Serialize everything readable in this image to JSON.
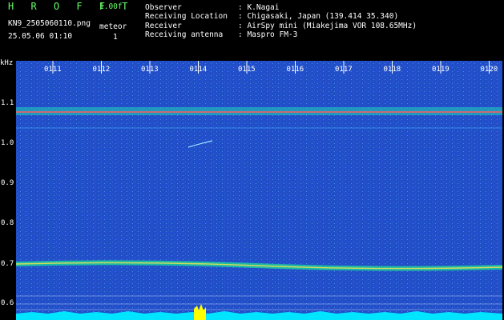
{
  "header": {
    "program": "H R O F F T",
    "version": "1.00f",
    "filename": "KN9_2505060110.png",
    "datetime": "25.05.06 01:10",
    "meteor_label": "meteor",
    "meteor_count": "1"
  },
  "info": {
    "labels": [
      "Observer",
      "Receiving Location",
      "Receiver",
      "Receiving antenna"
    ],
    "values": [
      ": K.Nagai",
      ": Chigasaki, Japan (139.414 35.340)",
      ": AirSpy mini (Miakejima VOR 108.65MHz)",
      ": Maspro FM-3"
    ]
  },
  "axis": {
    "y_unit": "kHz",
    "y_ticks": [
      "1.1",
      "1.0",
      "0.9",
      "0.8",
      "0.7",
      "0.6"
    ],
    "x_ticks": [
      "0111",
      "0112",
      "0113",
      "0114",
      "0115",
      "0116",
      "0117",
      "0118",
      "0119",
      "0120"
    ]
  },
  "colors": {
    "background_noise": "#0a1a6e",
    "signal": "#22ffcc",
    "strong_signal": "#ff5050",
    "baseline": "#00ffff",
    "meteor_marker": "#ffff00"
  }
}
